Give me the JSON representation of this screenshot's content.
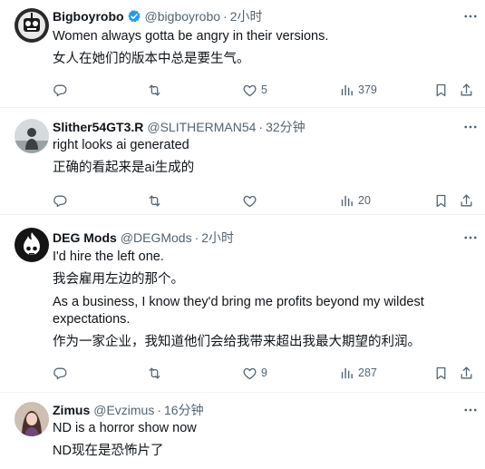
{
  "tweets": [
    {
      "author": "Bigboyrobo",
      "handle": "@bigboyrobo",
      "separator": "·",
      "time": "2小时",
      "verified": true,
      "text_lines": [
        "Women always gotta be angry in their versions.",
        "女人在她们的版本中总是要生气。"
      ],
      "counts": {
        "replies": "",
        "retweets": "",
        "likes": "5",
        "views": "379"
      }
    },
    {
      "author": "Slither54GT3.R",
      "handle": "@SLITHERMAN54",
      "separator": "·",
      "time": "32分钟",
      "verified": false,
      "text_lines": [
        "right looks ai generated",
        "正确的看起来是ai生成的"
      ],
      "counts": {
        "replies": "",
        "retweets": "",
        "likes": "",
        "views": "20"
      }
    },
    {
      "author": "DEG Mods",
      "handle": "@DEGMods",
      "separator": "·",
      "time": "2小时",
      "verified": false,
      "text_lines": [
        "I'd hire the left one.",
        "我会雇用左边的那个。",
        "As a business, I know they'd bring me profits beyond my wildest",
        "expectations.",
        "作为一家企业，我知道他们会给我带来超出我最大期望的利润。"
      ],
      "counts": {
        "replies": "",
        "retweets": "",
        "likes": "9",
        "views": "287"
      }
    },
    {
      "author": "Zimus",
      "handle": "@Evzimus",
      "separator": "·",
      "time": "16分钟",
      "verified": false,
      "text_lines": [
        "ND is a horror show now",
        "ND现在是恐怖片了"
      ],
      "counts": {
        "replies": "",
        "retweets": "",
        "likes": "",
        "views": ""
      }
    }
  ],
  "colors": {
    "text": "#0f1419",
    "muted": "#536471",
    "divider": "#eff3f4",
    "verified": "#1d9bf0"
  },
  "icons": [
    "more-icon",
    "reply-icon",
    "retweet-icon",
    "like-icon",
    "views-icon",
    "bookmark-icon",
    "share-icon",
    "verified-badge-icon"
  ]
}
